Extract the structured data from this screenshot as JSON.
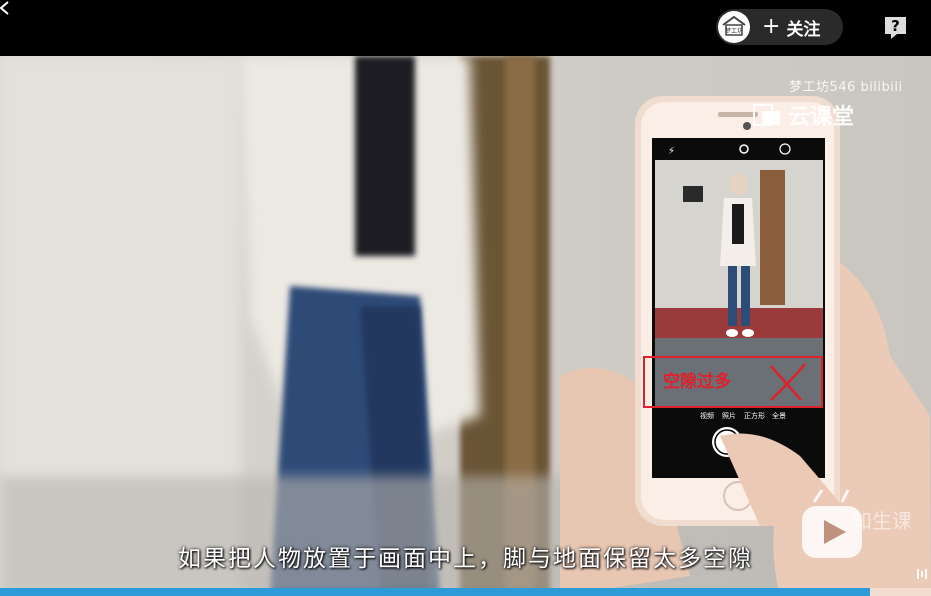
{
  "topbar": {
    "back_icon": "chevron-left-icon",
    "follow": {
      "avatar_text": "梦工坊",
      "plus": "+",
      "label": "关注"
    },
    "help_icon": "question-mark-icon",
    "help_glyph": "?"
  },
  "video": {
    "watermark_channel": "梦工坊546 bilibili",
    "watermark_brand": "云课堂",
    "phone_modes": [
      "视频",
      "照片",
      "正方形",
      "全景"
    ],
    "annotation": {
      "text": "空隙过多",
      "mark": "✕",
      "color": "#e0202a"
    },
    "subtitle": "如果把人物放置于画面中上，脚与地面保留太多空隙",
    "corner_logo": "知生课",
    "progress_fraction": 0.935
  },
  "colors": {
    "accent": "#2d9bd8",
    "annotation": "#e0202a"
  }
}
